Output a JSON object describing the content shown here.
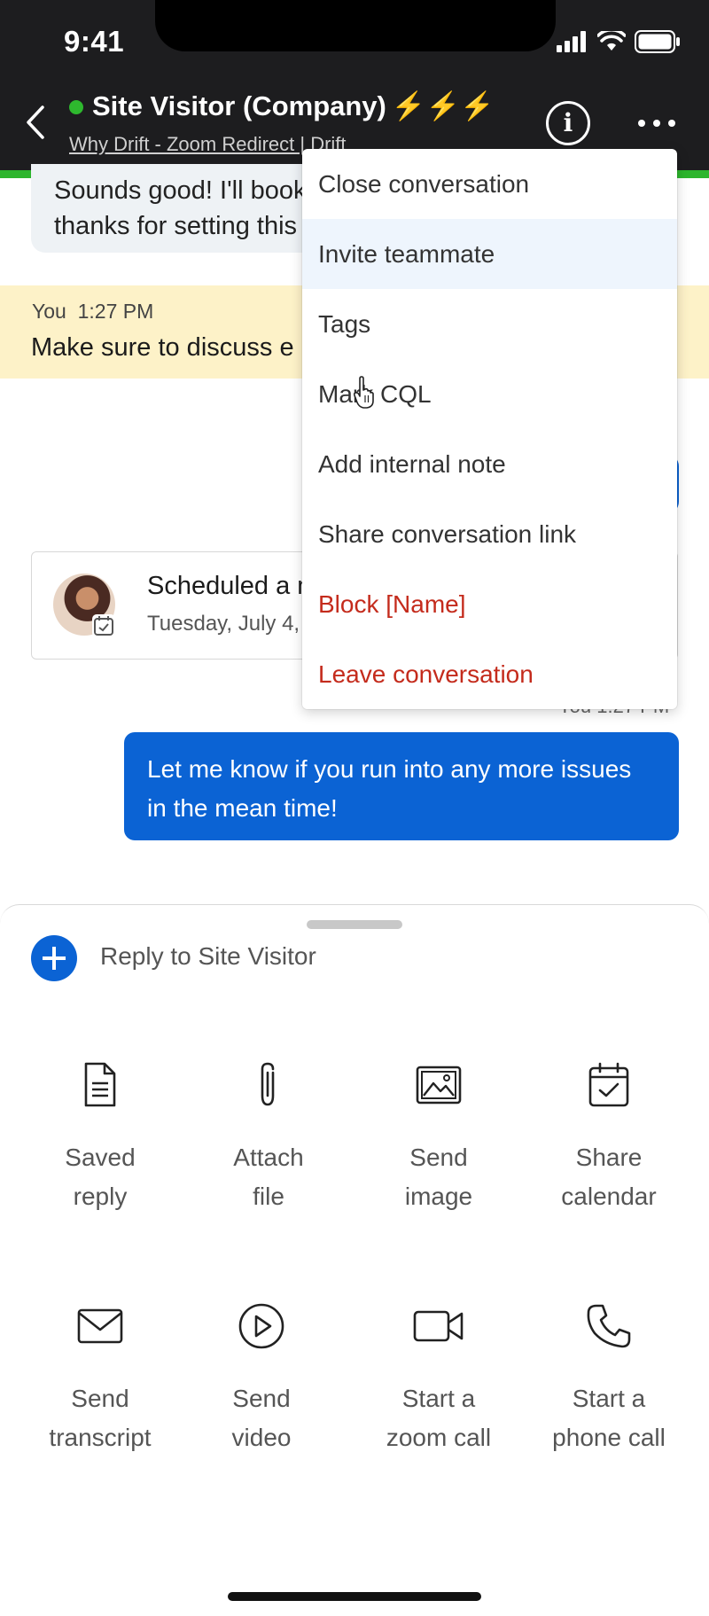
{
  "status_bar": {
    "time": "9:41"
  },
  "header": {
    "title": "Site Visitor (Company)",
    "title_emoji": "⚡⚡⚡",
    "subtitle": "Why Drift - Zoom Redirect | Drift",
    "presence_color": "#2eb82e"
  },
  "conversation": {
    "previous_message": "Sounds good! I'll book\nthanks for setting this",
    "note": {
      "author": "You",
      "time": "1:27 PM",
      "text": "Make sure to discuss e"
    },
    "meeting": {
      "title": "Scheduled a m",
      "date": "Tuesday, July 4,"
    },
    "last_message_time": "You 1:27 PM",
    "last_message": "Let me know if you run into any more issues in the mean time!"
  },
  "menu": {
    "items": [
      {
        "label": "Close conversation",
        "danger": false
      },
      {
        "label": "Invite teammate",
        "danger": false,
        "highlighted": true
      },
      {
        "label": "Tags",
        "danger": false
      },
      {
        "label": "Mark CQL",
        "danger": false
      },
      {
        "label": "Add internal note",
        "danger": false
      },
      {
        "label": "Share conversation link",
        "danger": false
      },
      {
        "label": "Block [Name]",
        "danger": true
      },
      {
        "label": "Leave conversation",
        "danger": true
      }
    ]
  },
  "composer": {
    "reply_placeholder": "Reply to Site Visitor",
    "actions": [
      {
        "label_line1": "Saved",
        "label_line2": "reply",
        "icon": "document-icon"
      },
      {
        "label_line1": "Attach",
        "label_line2": "file",
        "icon": "paperclip-icon"
      },
      {
        "label_line1": "Send",
        "label_line2": "image",
        "icon": "image-icon"
      },
      {
        "label_line1": "Share",
        "label_line2": "calendar",
        "icon": "calendar-check-icon"
      },
      {
        "label_line1": "Send",
        "label_line2": "transcript",
        "icon": "envelope-icon"
      },
      {
        "label_line1": "Send",
        "label_line2": "video",
        "icon": "play-circle-icon"
      },
      {
        "label_line1": "Start a",
        "label_line2": "zoom call",
        "icon": "video-camera-icon"
      },
      {
        "label_line1": "Start a",
        "label_line2": "phone call",
        "icon": "phone-icon"
      }
    ]
  },
  "colors": {
    "accent_blue": "#0b63d4",
    "header_bg": "#1d1d1f",
    "green_bar": "#2db52d",
    "note_bg": "#fdf2c8",
    "danger": "#c42b1c"
  }
}
